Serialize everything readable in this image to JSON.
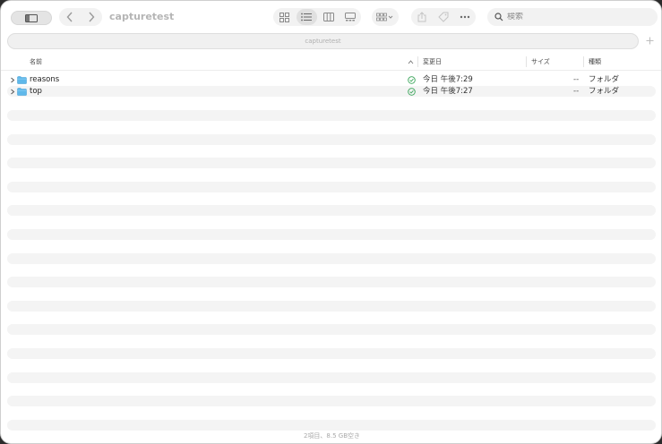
{
  "toolbar": {
    "title": "capturetest",
    "search_placeholder": "検索",
    "icons": [
      "sidebar-toggle-icon",
      "back-chevron-icon",
      "forward-chevron-icon",
      "icon-view-icon",
      "list-view-icon",
      "column-view-icon",
      "gallery-view-icon",
      "group-by-icon",
      "share-icon",
      "tag-icon",
      "more-icon",
      "search-icon"
    ]
  },
  "pathbar": {
    "label": "capturetest"
  },
  "columns": {
    "name": "名前",
    "date": "変更日",
    "size": "サイズ",
    "kind": "種類"
  },
  "rows": [
    {
      "name": "reasons",
      "date": "今日 午後7:29",
      "size": "--",
      "kind": "フォルダ"
    },
    {
      "name": "top",
      "date": "今日 午後7:27",
      "size": "--",
      "kind": "フォルダ"
    }
  ],
  "status": {
    "text": "2項目、8.5 GB空き"
  },
  "colors": {
    "folder": "#5fb8ea",
    "sync": "#3aa55a",
    "accent_bg": "#f4f4f4"
  }
}
